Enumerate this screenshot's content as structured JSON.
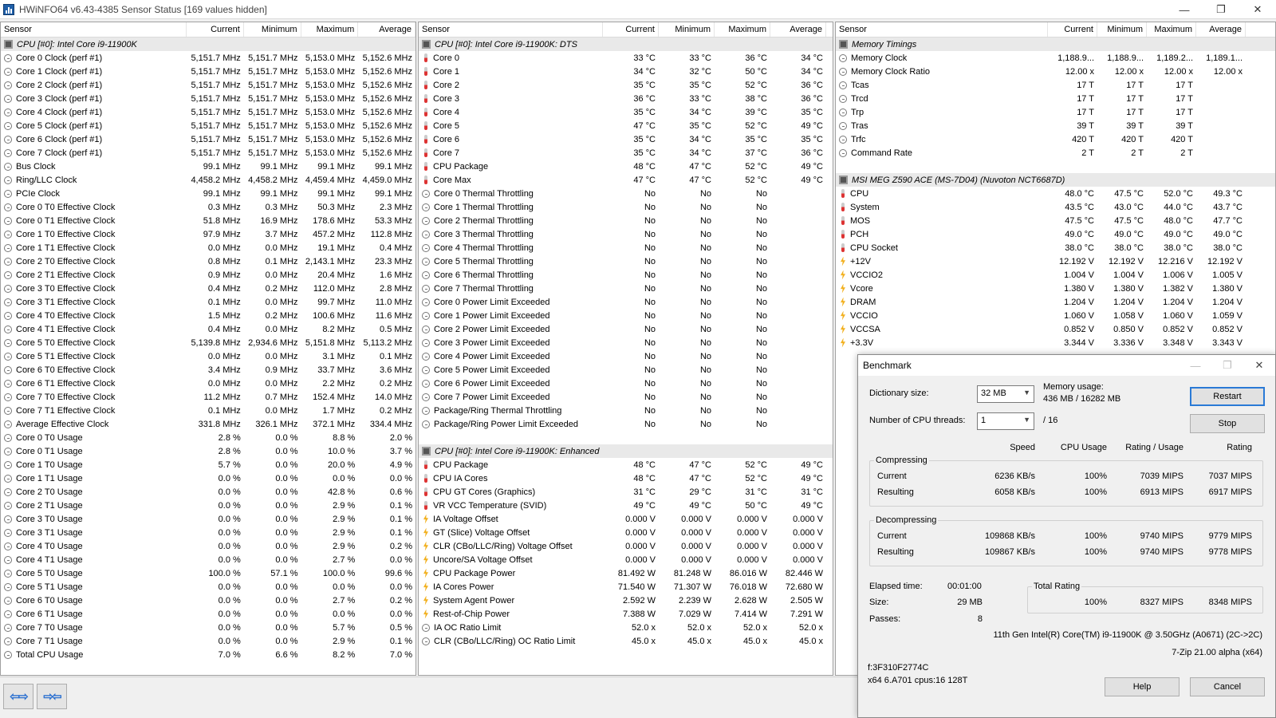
{
  "window": {
    "title": "HWiNFO64 v6.43-4385 Sensor Status [169 values hidden]",
    "controls": [
      "—",
      "❐",
      "✕"
    ]
  },
  "columns": {
    "sensor": "Sensor",
    "current": "Current",
    "minimum": "Minimum",
    "maximum": "Maximum",
    "average": "Average"
  },
  "pane1": [
    {
      "group": "CPU [#0]: Intel Core i9-11900K"
    },
    {
      "icon": "clock",
      "name": "Core 0 Clock (perf #1)",
      "v": [
        "5,151.7 MHz",
        "5,151.7 MHz",
        "5,153.0 MHz",
        "5,152.6 MHz"
      ]
    },
    {
      "icon": "clock",
      "name": "Core 1 Clock (perf #1)",
      "v": [
        "5,151.7 MHz",
        "5,151.7 MHz",
        "5,153.0 MHz",
        "5,152.6 MHz"
      ]
    },
    {
      "icon": "clock",
      "name": "Core 2 Clock (perf #1)",
      "v": [
        "5,151.7 MHz",
        "5,151.7 MHz",
        "5,153.0 MHz",
        "5,152.6 MHz"
      ]
    },
    {
      "icon": "clock",
      "name": "Core 3 Clock (perf #1)",
      "v": [
        "5,151.7 MHz",
        "5,151.7 MHz",
        "5,153.0 MHz",
        "5,152.6 MHz"
      ]
    },
    {
      "icon": "clock",
      "name": "Core 4 Clock (perf #1)",
      "v": [
        "5,151.7 MHz",
        "5,151.7 MHz",
        "5,153.0 MHz",
        "5,152.6 MHz"
      ]
    },
    {
      "icon": "clock",
      "name": "Core 5 Clock (perf #1)",
      "v": [
        "5,151.7 MHz",
        "5,151.7 MHz",
        "5,153.0 MHz",
        "5,152.6 MHz"
      ]
    },
    {
      "icon": "clock",
      "name": "Core 6 Clock (perf #1)",
      "v": [
        "5,151.7 MHz",
        "5,151.7 MHz",
        "5,153.0 MHz",
        "5,152.6 MHz"
      ]
    },
    {
      "icon": "clock",
      "name": "Core 7 Clock (perf #1)",
      "v": [
        "5,151.7 MHz",
        "5,151.7 MHz",
        "5,153.0 MHz",
        "5,152.6 MHz"
      ]
    },
    {
      "icon": "clock",
      "name": "Bus Clock",
      "v": [
        "99.1 MHz",
        "99.1 MHz",
        "99.1 MHz",
        "99.1 MHz"
      ]
    },
    {
      "icon": "clock",
      "name": "Ring/LLC Clock",
      "v": [
        "4,458.2 MHz",
        "4,458.2 MHz",
        "4,459.4 MHz",
        "4,459.0 MHz"
      ]
    },
    {
      "icon": "clock",
      "name": "PCIe Clock",
      "v": [
        "99.1 MHz",
        "99.1 MHz",
        "99.1 MHz",
        "99.1 MHz"
      ]
    },
    {
      "icon": "clock",
      "name": "Core 0 T0 Effective Clock",
      "v": [
        "0.3 MHz",
        "0.3 MHz",
        "50.3 MHz",
        "2.3 MHz"
      ]
    },
    {
      "icon": "clock",
      "name": "Core 0 T1 Effective Clock",
      "v": [
        "51.8 MHz",
        "16.9 MHz",
        "178.6 MHz",
        "53.3 MHz"
      ]
    },
    {
      "icon": "clock",
      "name": "Core 1 T0 Effective Clock",
      "v": [
        "97.9 MHz",
        "3.7 MHz",
        "457.2 MHz",
        "112.8 MHz"
      ]
    },
    {
      "icon": "clock",
      "name": "Core 1 T1 Effective Clock",
      "v": [
        "0.0 MHz",
        "0.0 MHz",
        "19.1 MHz",
        "0.4 MHz"
      ]
    },
    {
      "icon": "clock",
      "name": "Core 2 T0 Effective Clock",
      "v": [
        "0.8 MHz",
        "0.1 MHz",
        "2,143.1 MHz",
        "23.3 MHz"
      ]
    },
    {
      "icon": "clock",
      "name": "Core 2 T1 Effective Clock",
      "v": [
        "0.9 MHz",
        "0.0 MHz",
        "20.4 MHz",
        "1.6 MHz"
      ]
    },
    {
      "icon": "clock",
      "name": "Core 3 T0 Effective Clock",
      "v": [
        "0.4 MHz",
        "0.2 MHz",
        "112.0 MHz",
        "2.8 MHz"
      ]
    },
    {
      "icon": "clock",
      "name": "Core 3 T1 Effective Clock",
      "v": [
        "0.1 MHz",
        "0.0 MHz",
        "99.7 MHz",
        "11.0 MHz"
      ]
    },
    {
      "icon": "clock",
      "name": "Core 4 T0 Effective Clock",
      "v": [
        "1.5 MHz",
        "0.2 MHz",
        "100.6 MHz",
        "11.6 MHz"
      ]
    },
    {
      "icon": "clock",
      "name": "Core 4 T1 Effective Clock",
      "v": [
        "0.4 MHz",
        "0.0 MHz",
        "8.2 MHz",
        "0.5 MHz"
      ]
    },
    {
      "icon": "clock",
      "name": "Core 5 T0 Effective Clock",
      "v": [
        "5,139.8 MHz",
        "2,934.6 MHz",
        "5,151.8 MHz",
        "5,113.2 MHz"
      ]
    },
    {
      "icon": "clock",
      "name": "Core 5 T1 Effective Clock",
      "v": [
        "0.0 MHz",
        "0.0 MHz",
        "3.1 MHz",
        "0.1 MHz"
      ]
    },
    {
      "icon": "clock",
      "name": "Core 6 T0 Effective Clock",
      "v": [
        "3.4 MHz",
        "0.9 MHz",
        "33.7 MHz",
        "3.6 MHz"
      ]
    },
    {
      "icon": "clock",
      "name": "Core 6 T1 Effective Clock",
      "v": [
        "0.0 MHz",
        "0.0 MHz",
        "2.2 MHz",
        "0.2 MHz"
      ]
    },
    {
      "icon": "clock",
      "name": "Core 7 T0 Effective Clock",
      "v": [
        "11.2 MHz",
        "0.7 MHz",
        "152.4 MHz",
        "14.0 MHz"
      ]
    },
    {
      "icon": "clock",
      "name": "Core 7 T1 Effective Clock",
      "v": [
        "0.1 MHz",
        "0.0 MHz",
        "1.7 MHz",
        "0.2 MHz"
      ]
    },
    {
      "icon": "clock",
      "name": "Average Effective Clock",
      "v": [
        "331.8 MHz",
        "326.1 MHz",
        "372.1 MHz",
        "334.4 MHz"
      ]
    },
    {
      "icon": "clock",
      "name": "Core 0 T0 Usage",
      "v": [
        "2.8 %",
        "0.0 %",
        "8.8 %",
        "2.0 %"
      ]
    },
    {
      "icon": "clock",
      "name": "Core 0 T1 Usage",
      "v": [
        "2.8 %",
        "0.0 %",
        "10.0 %",
        "3.7 %"
      ]
    },
    {
      "icon": "clock",
      "name": "Core 1 T0 Usage",
      "v": [
        "5.7 %",
        "0.0 %",
        "20.0 %",
        "4.9 %"
      ]
    },
    {
      "icon": "clock",
      "name": "Core 1 T1 Usage",
      "v": [
        "0.0 %",
        "0.0 %",
        "0.0 %",
        "0.0 %"
      ]
    },
    {
      "icon": "clock",
      "name": "Core 2 T0 Usage",
      "v": [
        "0.0 %",
        "0.0 %",
        "42.8 %",
        "0.6 %"
      ]
    },
    {
      "icon": "clock",
      "name": "Core 2 T1 Usage",
      "v": [
        "0.0 %",
        "0.0 %",
        "2.9 %",
        "0.1 %"
      ]
    },
    {
      "icon": "clock",
      "name": "Core 3 T0 Usage",
      "v": [
        "0.0 %",
        "0.0 %",
        "2.9 %",
        "0.1 %"
      ]
    },
    {
      "icon": "clock",
      "name": "Core 3 T1 Usage",
      "v": [
        "0.0 %",
        "0.0 %",
        "2.9 %",
        "0.1 %"
      ]
    },
    {
      "icon": "clock",
      "name": "Core 4 T0 Usage",
      "v": [
        "0.0 %",
        "0.0 %",
        "2.9 %",
        "0.2 %"
      ]
    },
    {
      "icon": "clock",
      "name": "Core 4 T1 Usage",
      "v": [
        "0.0 %",
        "0.0 %",
        "2.7 %",
        "0.0 %"
      ]
    },
    {
      "icon": "clock",
      "name": "Core 5 T0 Usage",
      "v": [
        "100.0 %",
        "57.1 %",
        "100.0 %",
        "99.6 %"
      ]
    },
    {
      "icon": "clock",
      "name": "Core 5 T1 Usage",
      "v": [
        "0.0 %",
        "0.0 %",
        "0.0 %",
        "0.0 %"
      ]
    },
    {
      "icon": "clock",
      "name": "Core 6 T0 Usage",
      "v": [
        "0.0 %",
        "0.0 %",
        "2.7 %",
        "0.2 %"
      ]
    },
    {
      "icon": "clock",
      "name": "Core 6 T1 Usage",
      "v": [
        "0.0 %",
        "0.0 %",
        "0.0 %",
        "0.0 %"
      ]
    },
    {
      "icon": "clock",
      "name": "Core 7 T0 Usage",
      "v": [
        "0.0 %",
        "0.0 %",
        "5.7 %",
        "0.5 %"
      ]
    },
    {
      "icon": "clock",
      "name": "Core 7 T1 Usage",
      "v": [
        "0.0 %",
        "0.0 %",
        "2.9 %",
        "0.1 %"
      ]
    },
    {
      "icon": "clock",
      "name": "Total CPU Usage",
      "v": [
        "7.0 %",
        "6.6 %",
        "8.2 %",
        "7.0 %"
      ]
    }
  ],
  "pane2": [
    {
      "group": "CPU [#0]: Intel Core i9-11900K: DTS"
    },
    {
      "icon": "temp",
      "name": "Core 0",
      "v": [
        "33 °C",
        "33 °C",
        "36 °C",
        "34 °C"
      ]
    },
    {
      "icon": "temp",
      "name": "Core 1",
      "v": [
        "34 °C",
        "32 °C",
        "50 °C",
        "34 °C"
      ]
    },
    {
      "icon": "temp",
      "name": "Core 2",
      "v": [
        "35 °C",
        "35 °C",
        "52 °C",
        "36 °C"
      ]
    },
    {
      "icon": "temp",
      "name": "Core 3",
      "v": [
        "36 °C",
        "33 °C",
        "38 °C",
        "36 °C"
      ]
    },
    {
      "icon": "temp",
      "name": "Core 4",
      "v": [
        "35 °C",
        "34 °C",
        "39 °C",
        "35 °C"
      ]
    },
    {
      "icon": "temp",
      "name": "Core 5",
      "v": [
        "47 °C",
        "35 °C",
        "52 °C",
        "49 °C"
      ]
    },
    {
      "icon": "temp",
      "name": "Core 6",
      "v": [
        "35 °C",
        "34 °C",
        "35 °C",
        "35 °C"
      ]
    },
    {
      "icon": "temp",
      "name": "Core 7",
      "v": [
        "35 °C",
        "34 °C",
        "37 °C",
        "36 °C"
      ]
    },
    {
      "icon": "temp",
      "name": "CPU Package",
      "v": [
        "48 °C",
        "47 °C",
        "52 °C",
        "49 °C"
      ]
    },
    {
      "icon": "temp",
      "name": "Core Max",
      "v": [
        "47 °C",
        "47 °C",
        "52 °C",
        "49 °C"
      ]
    },
    {
      "icon": "clock",
      "name": "Core 0 Thermal Throttling",
      "v": [
        "No",
        "No",
        "No",
        ""
      ]
    },
    {
      "icon": "clock",
      "name": "Core 1 Thermal Throttling",
      "v": [
        "No",
        "No",
        "No",
        ""
      ]
    },
    {
      "icon": "clock",
      "name": "Core 2 Thermal Throttling",
      "v": [
        "No",
        "No",
        "No",
        ""
      ]
    },
    {
      "icon": "clock",
      "name": "Core 3 Thermal Throttling",
      "v": [
        "No",
        "No",
        "No",
        ""
      ]
    },
    {
      "icon": "clock",
      "name": "Core 4 Thermal Throttling",
      "v": [
        "No",
        "No",
        "No",
        ""
      ]
    },
    {
      "icon": "clock",
      "name": "Core 5 Thermal Throttling",
      "v": [
        "No",
        "No",
        "No",
        ""
      ]
    },
    {
      "icon": "clock",
      "name": "Core 6 Thermal Throttling",
      "v": [
        "No",
        "No",
        "No",
        ""
      ]
    },
    {
      "icon": "clock",
      "name": "Core 7 Thermal Throttling",
      "v": [
        "No",
        "No",
        "No",
        ""
      ]
    },
    {
      "icon": "clock",
      "name": "Core 0 Power Limit Exceeded",
      "v": [
        "No",
        "No",
        "No",
        ""
      ]
    },
    {
      "icon": "clock",
      "name": "Core 1 Power Limit Exceeded",
      "v": [
        "No",
        "No",
        "No",
        ""
      ]
    },
    {
      "icon": "clock",
      "name": "Core 2 Power Limit Exceeded",
      "v": [
        "No",
        "No",
        "No",
        ""
      ]
    },
    {
      "icon": "clock",
      "name": "Core 3 Power Limit Exceeded",
      "v": [
        "No",
        "No",
        "No",
        ""
      ]
    },
    {
      "icon": "clock",
      "name": "Core 4 Power Limit Exceeded",
      "v": [
        "No",
        "No",
        "No",
        ""
      ]
    },
    {
      "icon": "clock",
      "name": "Core 5 Power Limit Exceeded",
      "v": [
        "No",
        "No",
        "No",
        ""
      ]
    },
    {
      "icon": "clock",
      "name": "Core 6 Power Limit Exceeded",
      "v": [
        "No",
        "No",
        "No",
        ""
      ]
    },
    {
      "icon": "clock",
      "name": "Core 7 Power Limit Exceeded",
      "v": [
        "No",
        "No",
        "No",
        ""
      ]
    },
    {
      "icon": "clock",
      "name": "Package/Ring Thermal Throttling",
      "v": [
        "No",
        "No",
        "No",
        ""
      ]
    },
    {
      "icon": "clock",
      "name": "Package/Ring Power Limit Exceeded",
      "v": [
        "No",
        "No",
        "No",
        ""
      ]
    },
    {
      "blank": true
    },
    {
      "group": "CPU [#0]: Intel Core i9-11900K: Enhanced"
    },
    {
      "icon": "temp",
      "name": "CPU Package",
      "v": [
        "48 °C",
        "47 °C",
        "52 °C",
        "49 °C"
      ]
    },
    {
      "icon": "temp",
      "name": "CPU IA Cores",
      "v": [
        "48 °C",
        "47 °C",
        "52 °C",
        "49 °C"
      ]
    },
    {
      "icon": "temp",
      "name": "CPU GT Cores (Graphics)",
      "v": [
        "31 °C",
        "29 °C",
        "31 °C",
        "31 °C"
      ]
    },
    {
      "icon": "temp",
      "name": "VR VCC Temperature (SVID)",
      "v": [
        "49 °C",
        "49 °C",
        "50 °C",
        "49 °C"
      ]
    },
    {
      "icon": "volt",
      "name": "IA Voltage Offset",
      "v": [
        "0.000 V",
        "0.000 V",
        "0.000 V",
        "0.000 V"
      ]
    },
    {
      "icon": "volt",
      "name": "GT (Slice) Voltage Offset",
      "v": [
        "0.000 V",
        "0.000 V",
        "0.000 V",
        "0.000 V"
      ]
    },
    {
      "icon": "volt",
      "name": "CLR (CBo/LLC/Ring) Voltage Offset",
      "v": [
        "0.000 V",
        "0.000 V",
        "0.000 V",
        "0.000 V"
      ]
    },
    {
      "icon": "volt",
      "name": "Uncore/SA Voltage Offset",
      "v": [
        "0.000 V",
        "0.000 V",
        "0.000 V",
        "0.000 V"
      ]
    },
    {
      "icon": "volt",
      "name": "CPU Package Power",
      "v": [
        "81.492 W",
        "81.248 W",
        "86.016 W",
        "82.446 W"
      ]
    },
    {
      "icon": "volt",
      "name": "IA Cores Power",
      "v": [
        "71.540 W",
        "71.307 W",
        "76.018 W",
        "72.680 W"
      ]
    },
    {
      "icon": "volt",
      "name": "System Agent Power",
      "v": [
        "2.592 W",
        "2.239 W",
        "2.628 W",
        "2.505 W"
      ]
    },
    {
      "icon": "volt",
      "name": "Rest-of-Chip Power",
      "v": [
        "7.388 W",
        "7.029 W",
        "7.414 W",
        "7.291 W"
      ]
    },
    {
      "icon": "clock",
      "name": "IA OC Ratio Limit",
      "v": [
        "52.0 x",
        "52.0 x",
        "52.0 x",
        "52.0 x"
      ]
    },
    {
      "icon": "clock",
      "name": "CLR (CBo/LLC/Ring) OC Ratio Limit",
      "v": [
        "45.0 x",
        "45.0 x",
        "45.0 x",
        "45.0 x"
      ]
    }
  ],
  "pane3": [
    {
      "group": "Memory Timings"
    },
    {
      "icon": "clock",
      "name": "Memory Clock",
      "v": [
        "1,188.9...",
        "1,188.9...",
        "1,189.2...",
        "1,189.1..."
      ]
    },
    {
      "icon": "clock",
      "name": "Memory Clock Ratio",
      "v": [
        "12.00 x",
        "12.00 x",
        "12.00 x",
        "12.00 x"
      ]
    },
    {
      "icon": "clock",
      "name": "Tcas",
      "v": [
        "17 T",
        "17 T",
        "17 T",
        ""
      ]
    },
    {
      "icon": "clock",
      "name": "Trcd",
      "v": [
        "17 T",
        "17 T",
        "17 T",
        ""
      ]
    },
    {
      "icon": "clock",
      "name": "Trp",
      "v": [
        "17 T",
        "17 T",
        "17 T",
        ""
      ]
    },
    {
      "icon": "clock",
      "name": "Tras",
      "v": [
        "39 T",
        "39 T",
        "39 T",
        ""
      ]
    },
    {
      "icon": "clock",
      "name": "Trfc",
      "v": [
        "420 T",
        "420 T",
        "420 T",
        ""
      ]
    },
    {
      "icon": "clock",
      "name": "Command Rate",
      "v": [
        "2 T",
        "2 T",
        "2 T",
        ""
      ]
    },
    {
      "blank": true
    },
    {
      "group": "MSI MEG Z590 ACE (MS-7D04) (Nuvoton NCT6687D)"
    },
    {
      "icon": "temp",
      "name": "CPU",
      "v": [
        "48.0 °C",
        "47.5 °C",
        "52.0 °C",
        "49.3 °C"
      ]
    },
    {
      "icon": "temp",
      "name": "System",
      "v": [
        "43.5 °C",
        "43.0 °C",
        "44.0 °C",
        "43.7 °C"
      ]
    },
    {
      "icon": "temp",
      "name": "MOS",
      "v": [
        "47.5 °C",
        "47.5 °C",
        "48.0 °C",
        "47.7 °C"
      ]
    },
    {
      "icon": "temp",
      "name": "PCH",
      "v": [
        "49.0 °C",
        "49.0 °C",
        "49.0 °C",
        "49.0 °C"
      ]
    },
    {
      "icon": "temp",
      "name": "CPU Socket",
      "v": [
        "38.0 °C",
        "38.0 °C",
        "38.0 °C",
        "38.0 °C"
      ]
    },
    {
      "icon": "volt",
      "name": "+12V",
      "v": [
        "12.192 V",
        "12.192 V",
        "12.216 V",
        "12.192 V"
      ]
    },
    {
      "icon": "volt",
      "name": "VCCIO2",
      "v": [
        "1.004 V",
        "1.004 V",
        "1.006 V",
        "1.005 V"
      ]
    },
    {
      "icon": "volt",
      "name": "Vcore",
      "v": [
        "1.380 V",
        "1.380 V",
        "1.382 V",
        "1.380 V"
      ]
    },
    {
      "icon": "volt",
      "name": "DRAM",
      "v": [
        "1.204 V",
        "1.204 V",
        "1.204 V",
        "1.204 V"
      ]
    },
    {
      "icon": "volt",
      "name": "VCCIO",
      "v": [
        "1.060 V",
        "1.058 V",
        "1.060 V",
        "1.059 V"
      ]
    },
    {
      "icon": "volt",
      "name": "VCCSA",
      "v": [
        "0.852 V",
        "0.850 V",
        "0.852 V",
        "0.852 V"
      ]
    },
    {
      "icon": "volt",
      "name": "+3.3V",
      "v": [
        "3.344 V",
        "3.336 V",
        "3.348 V",
        "3.343 V"
      ]
    }
  ],
  "benchmark": {
    "title": "Benchmark",
    "dict_label": "Dictionary size:",
    "dict_value": "32 MB",
    "threads_label": "Number of CPU threads:",
    "threads_value": "1",
    "threads_total": "/ 16",
    "mem_label": "Memory usage:",
    "mem_value": "436 MB / 16282 MB",
    "restart": "Restart",
    "stop": "Stop",
    "col_speed": "Speed",
    "col_cpu": "CPU Usage",
    "col_ru": "Rating / Usage",
    "col_rating": "Rating",
    "compressing": "Compressing",
    "decompressing": "Decompressing",
    "current": "Current",
    "resulting": "Resulting",
    "comp_cur": [
      "6236 KB/s",
      "100%",
      "7039 MIPS",
      "7037 MIPS"
    ],
    "comp_res": [
      "6058 KB/s",
      "100%",
      "6913 MIPS",
      "6917 MIPS"
    ],
    "dec_cur": [
      "109868 KB/s",
      "100%",
      "9740 MIPS",
      "9779 MIPS"
    ],
    "dec_res": [
      "109867 KB/s",
      "100%",
      "9740 MIPS",
      "9778 MIPS"
    ],
    "elapsed_label": "Elapsed time:",
    "elapsed": "00:01:00",
    "size_label": "Size:",
    "size": "29 MB",
    "passes_label": "Passes:",
    "passes": "8",
    "total_label": "Total Rating",
    "total": [
      "100%",
      "8327 MIPS",
      "8348 MIPS"
    ],
    "cpu_info": "11th Gen Intel(R) Core(TM) i9-11900K @ 3.50GHz (A0671) (2C->2C)",
    "zip_version": "7-Zip 21.00 alpha (x64)",
    "code": "f:3F310F2774C",
    "arch": "x64 6.A701 cpus:16 128T",
    "help": "Help",
    "cancel": "Cancel"
  }
}
